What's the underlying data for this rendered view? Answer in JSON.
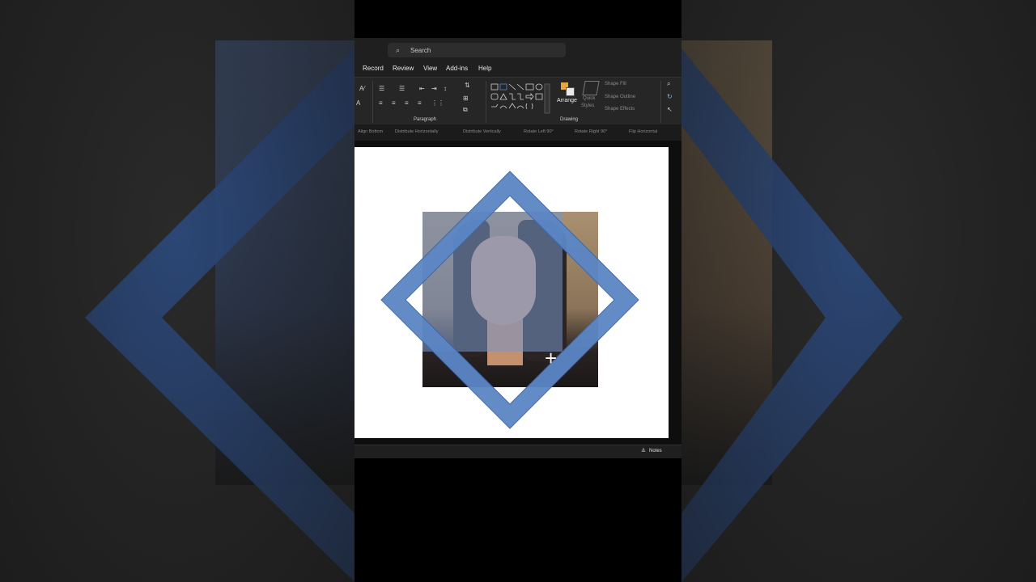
{
  "search": {
    "placeholder": "Search"
  },
  "menu": [
    "Record",
    "Review",
    "View",
    "Add-ins",
    "Help"
  ],
  "ribbon": {
    "groups": {
      "paragraph": "Paragraph",
      "drawing": "Drawing"
    },
    "arrange": "Arrange",
    "quick_styles": [
      "Quick",
      "Styles"
    ],
    "shape_fill": "Shape Fill",
    "shape_outline": "Shape Outline",
    "shape_effects": "Shape Effects"
  },
  "qat": [
    "Align Bottom",
    "Distribute Horizontally",
    "Distribute Vertically",
    "Rotate Left 90°",
    "Rotate Right 90°",
    "Flip Horizontal"
  ],
  "status": {
    "notes": "Notes"
  },
  "colors": {
    "diamond": "#5b86c5",
    "accent": "#e8a53a"
  }
}
